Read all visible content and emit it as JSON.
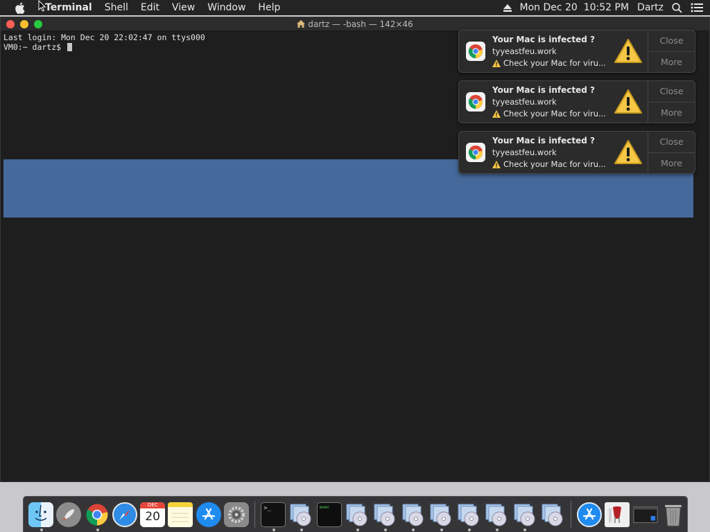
{
  "menubar": {
    "app_name": "Terminal",
    "menus": [
      "Shell",
      "Edit",
      "View",
      "Window",
      "Help"
    ],
    "clock": "Mon Dec 20  10:52 PM",
    "user": "Dartz",
    "icons": [
      "apple-icon",
      "eject-icon",
      "spotlight-search-icon",
      "notification-center-icon"
    ]
  },
  "terminal": {
    "title": "dartz — -bash — 142×46",
    "lines": [
      "Last login: Mon Dec 20 22:02:47 on ttys000",
      "VM0:~ dartz$ "
    ],
    "selection_color": "#46699b"
  },
  "notifications": [
    {
      "title": "Your Mac is infected ?",
      "subtitle": "tyyeastfeu.work",
      "body": "Check your Mac for viru...",
      "close_label": "Close",
      "more_label": "More"
    },
    {
      "title": "Your Mac is infected ?",
      "subtitle": "tyyeastfeu.work",
      "body": "Check your Mac for viru...",
      "close_label": "Close",
      "more_label": "More"
    },
    {
      "title": "Your Mac is infected ?",
      "subtitle": "tyyeastfeu.work",
      "body": "Check your Mac for viru...",
      "close_label": "Close",
      "more_label": "More"
    }
  ],
  "dock": {
    "calendar_month": "DEC",
    "calendar_day": "20",
    "terminal_prompt": ">_",
    "exec_label": "exec",
    "items": [
      "finder",
      "launchpad",
      "chrome",
      "safari",
      "calendar",
      "notes",
      "app-store",
      "system-preferences",
      "terminal",
      "disk-image",
      "exec",
      "disk-image",
      "disk-image",
      "disk-image",
      "disk-image",
      "disk-image",
      "disk-image",
      "disk-image",
      "app-store-download",
      "installer",
      "screen-window",
      "trash"
    ]
  }
}
